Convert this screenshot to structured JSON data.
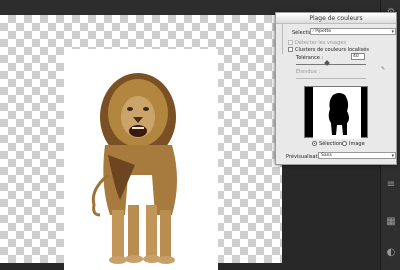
{
  "dialog": {
    "title": "Plage de couleurs",
    "selection_label": "Sélection :",
    "selection_value": "Pipette",
    "detect_faces": "Détecter les visages",
    "localized_clusters": "Clusters de couleurs localisés",
    "tolerance_label": "Tolérance :",
    "tolerance_value": "40",
    "range_label": "Étendue :",
    "view_selection": "Sélection",
    "view_image": "Image",
    "preset_label": "Prévisualisation :",
    "preset_value": "Sans"
  },
  "colors": {
    "workspace": "#282828",
    "dialog_bg": "#e9e9e9",
    "checker": "#cfcfcf"
  },
  "icons": [
    "menu-icon",
    "eyedropper-icon",
    "tool-icon"
  ]
}
